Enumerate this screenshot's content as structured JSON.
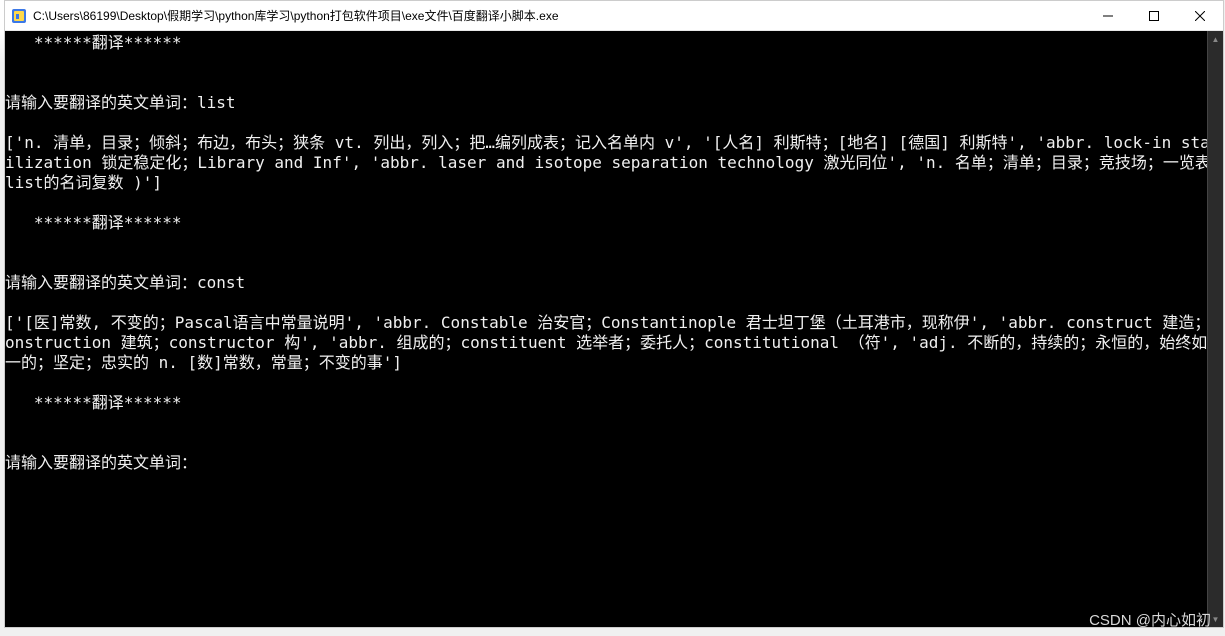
{
  "window": {
    "title": "C:\\Users\\86199\\Desktop\\假期学习\\python库学习\\python打包软件项目\\exe文件\\百度翻译小脚本.exe"
  },
  "console": {
    "header1": "   ******翻译******",
    "blank": "",
    "prompt1": "请输入要翻译的英文单词：list",
    "result1": "['n. 清单，目录；倾斜；布边，布头；狭条 vt. 列出，列入；把…编列成表；记入名单内 v', '[人名] 利斯特；[地名] [德国] 利斯特', 'abbr. lock-in stabilization 锁定稳定化；Library and Inf', 'abbr. laser and isotope separation technology 激光同位', 'n. 名单；清单；目录；竞技场；一览表( list的名词复数 )']",
    "header2": "   ******翻译******",
    "prompt2": "请输入要翻译的英文单词：const",
    "result2": "['[医]常数, 不变的；Pascal语言中常量说明', 'abbr. Constable 治安官；Constantinople 君士坦丁堡（土耳港市，现称伊', 'abbr. construct 建造；construction 建筑；constructor 构', 'abbr. 组成的；constituent 选举者；委托人；constitutional （符', 'adj. 不断的，持续的；永恒的，始终如一的；坚定；忠实的 n. [数]常数，常量；不变的事']",
    "header3": "   ******翻译******",
    "prompt3": "请输入要翻译的英文单词："
  },
  "watermark": "CSDN @内心如初"
}
